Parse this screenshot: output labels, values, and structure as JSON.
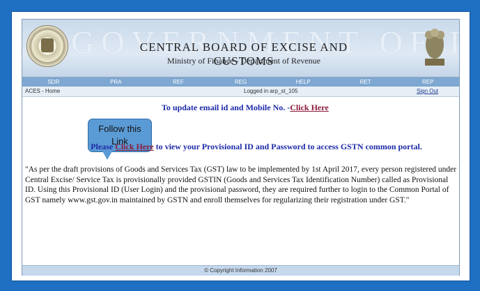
{
  "header": {
    "watermark": "GOVERNMENT OF INDIA",
    "title": "CENTRAL BOARD OF EXCISE AND CUSTOMS",
    "subtitle": "Ministry of Finance  - Department of Revenue"
  },
  "nav": {
    "items": [
      {
        "label": "SDR"
      },
      {
        "label": "PRA"
      },
      {
        "label": "REF"
      },
      {
        "label": "REG"
      },
      {
        "label": "HELP"
      },
      {
        "label": "RET"
      },
      {
        "label": "REP"
      }
    ]
  },
  "status": {
    "breadcrumb": "ACES - Home",
    "logged_in": "Logged in arp_st_105",
    "sign_out": "Sign Out"
  },
  "callout": {
    "line1": "Follow this",
    "line2": "Link"
  },
  "email": {
    "prefix": "To update email id and Mobile No. -",
    "link": "Click Here"
  },
  "gstn": {
    "prefix": "Please ",
    "link": "Click Here",
    "suffix": " to view your Provisional ID and Password to access GSTN common portal."
  },
  "paragraph": "\"As per the draft provisions of Goods and Services Tax (GST) law to be implemented by 1st April 2017, every person registered under Central Excise/ Service Tax is provisionally provided GSTIN (Goods and Services Tax Identification Number) called as Provisional ID. Using this Provisional ID (User Login) and the provisional password, they are required further to login to the Common Portal of GST namely www.gst.gov.in maintained by GSTN and enroll themselves for regularizing their registration under GST.\"",
  "footer": "© Copyright Information 2007",
  "colors": {
    "page_background": "#1f6fc2",
    "nav_bar": "#7ea7d1",
    "link_text": "#8b1a3a",
    "heading_text": "#1c2aa8",
    "callout": "#5b9bd5"
  }
}
